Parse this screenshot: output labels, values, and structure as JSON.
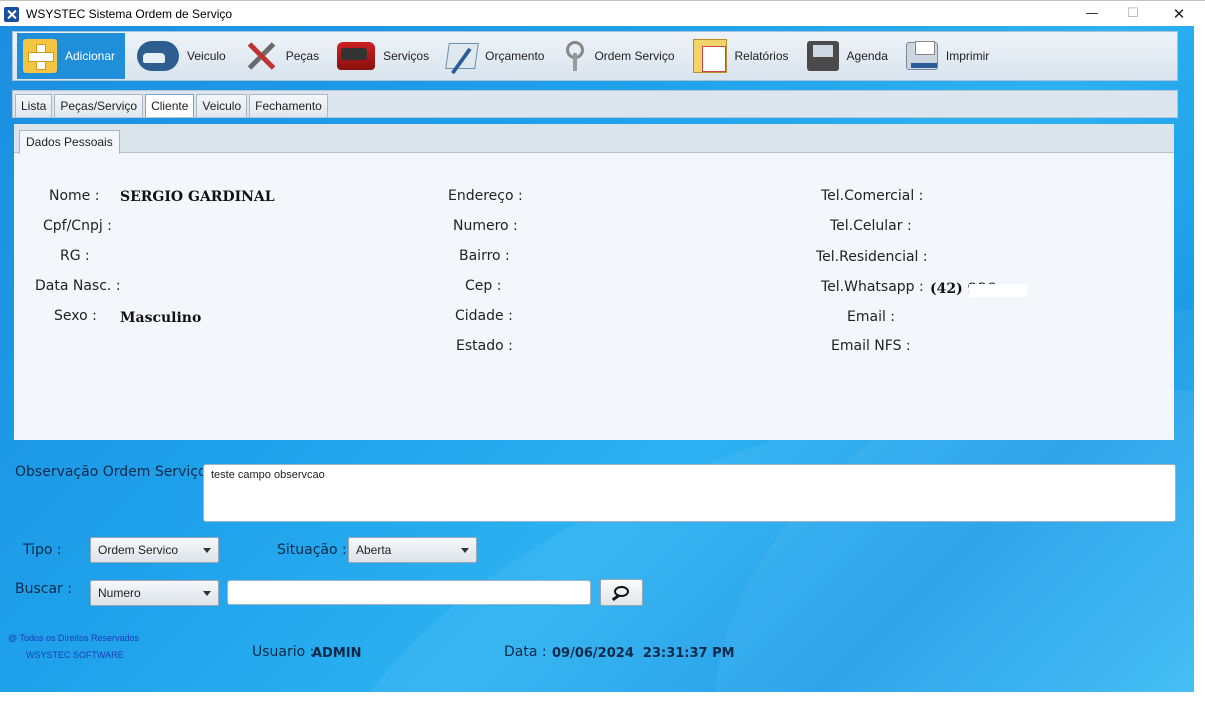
{
  "window": {
    "title": "WSYSTEC Sistema Ordem de Serviço",
    "minimize": "—",
    "maximize": "☐",
    "close": "✕"
  },
  "toolbar": {
    "items": [
      {
        "label": "Adicionar",
        "icon": "add-icon"
      },
      {
        "label": "Veiculo",
        "icon": "car-icon"
      },
      {
        "label": "Peças",
        "icon": "tools-icon"
      },
      {
        "label": "Serviços",
        "icon": "service-car-icon"
      },
      {
        "label": "Orçamento",
        "icon": "budget-icon"
      },
      {
        "label": "Ordem Serviço",
        "icon": "keys-icon"
      },
      {
        "label": "Relatórios",
        "icon": "report-icon"
      },
      {
        "label": "Agenda",
        "icon": "agenda-icon"
      },
      {
        "label": "Imprimir",
        "icon": "printer-icon"
      }
    ],
    "active": "Adicionar"
  },
  "tabs": [
    "Lista",
    "Peças/Serviço",
    "Cliente",
    "Veiculo",
    "Fechamento"
  ],
  "active_tab": "Cliente",
  "subtab": "Dados Pessoais",
  "client": {
    "col1": {
      "nome_label": "Nome :",
      "nome_value": "SERGIO GARDINAL",
      "cpf_label": "Cpf/Cnpj :",
      "rg_label": "RG :",
      "nasc_label": "Data Nasc. :",
      "sexo_label": "Sexo :",
      "sexo_value": "Masculino"
    },
    "col2": {
      "endereco_label": "Endereço :",
      "numero_label": "Numero :",
      "bairro_label": "Bairro :",
      "cep_label": "Cep :",
      "cidade_label": "Cidade :",
      "estado_label": "Estado :"
    },
    "col3": {
      "comercial_label": "Tel.Comercial :",
      "celular_label": "Tel.Celular :",
      "residencial_label": "Tel.Residencial :",
      "whatsapp_label": "Tel.Whatsapp :",
      "whatsapp_value": "(42) 990",
      "email_label": "Email :",
      "emailnfs_label": "Email NFS :"
    }
  },
  "observacao": {
    "label": "Observação Ordem Serviço :",
    "value": "teste campo observcao"
  },
  "tipo": {
    "label": "Tipo :",
    "selected": "Ordem Servico"
  },
  "situacao": {
    "label": "Situação :",
    "selected": "Aberta"
  },
  "buscar": {
    "label": "Buscar :",
    "selected": "Numero",
    "input_value": ""
  },
  "footer": {
    "copyright": "@ Todos os Direitos Reservados",
    "company": "WSYSTEC SOFTWARE",
    "usuario_label": "Usuario :",
    "usuario_value": "ADMIN",
    "data_label": "Data :",
    "data_value": "09/06/2024  23:31:37 PM"
  },
  "colors": {
    "background_blue": "#1ea0ea",
    "active_button": "#1e8fd8",
    "panel_bg": "#f3f6fa"
  }
}
